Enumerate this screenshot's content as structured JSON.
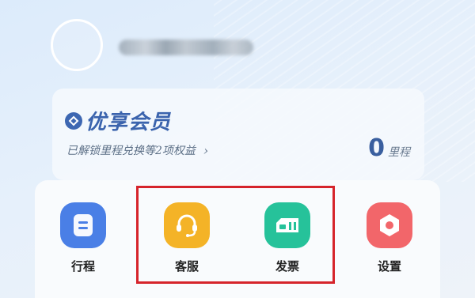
{
  "member": {
    "title": "优享会员",
    "subtitle": "已解锁里程兑换等2项权益",
    "chevron": "›",
    "points_value": "0",
    "points_unit": "里程"
  },
  "actions": [
    {
      "label": "行程",
      "icon": "itinerary-icon",
      "color": "#4a7fe6"
    },
    {
      "label": "客服",
      "icon": "headset-icon",
      "color": "#f4b327"
    },
    {
      "label": "发票",
      "icon": "invoice-icon",
      "color": "#26c29a"
    },
    {
      "label": "设置",
      "icon": "settings-icon",
      "color": "#f2666a"
    }
  ],
  "colors": {
    "accent": "#3a63ad",
    "highlight_box": "#d6242b"
  }
}
